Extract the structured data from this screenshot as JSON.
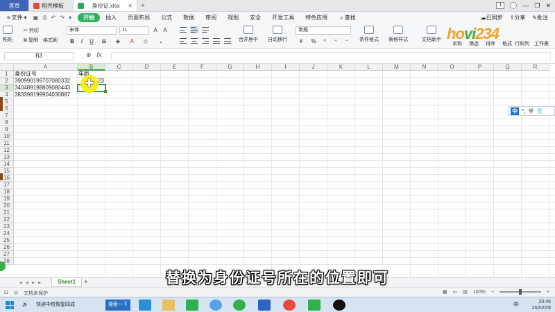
{
  "tabs": {
    "home": "首页",
    "template": "稻壳模板",
    "file": "身份证.xlsx",
    "tray_num": "1"
  },
  "menu": {
    "file": "文件",
    "items": [
      "开始",
      "插入",
      "页面布局",
      "公式",
      "数据",
      "审阅",
      "视图",
      "安全",
      "开发工具",
      "特色应用"
    ],
    "active_index": 0,
    "search": "查找",
    "sync": "已同步",
    "share": "分享",
    "comment": "批注"
  },
  "ribbon": {
    "paste": "粘贴",
    "cut": "剪切",
    "copy": "复制",
    "format_painter": "格式刷",
    "font_name": "宋体",
    "font_size": "11",
    "bold": "B",
    "italic": "I",
    "underline": "U",
    "merge": "合并居中",
    "wrap": "自动换行",
    "number_format": "常规",
    "conditional": "条件格式",
    "table_style": "表格样式",
    "doc_helper": "文档助手",
    "sum": "求和",
    "filter": "筛选",
    "sort": "排序",
    "fill": "格式",
    "row_col": "行和列",
    "worksheet": "工作表"
  },
  "logo": {
    "text_a": "ho",
    "text_b": "vi",
    "text_c": "234"
  },
  "formula_bar": {
    "name_box": "B3",
    "fx": "fx"
  },
  "grid": {
    "columns": [
      "A",
      "B",
      "C",
      "D",
      "E",
      "F",
      "G",
      "H",
      "I",
      "J",
      "K",
      "L",
      "M",
      "N",
      "O",
      "P",
      "Q",
      "R"
    ],
    "rows": [
      "1",
      "2",
      "3",
      "4",
      "5",
      "6",
      "7",
      "8",
      "9",
      "10",
      "11",
      "12",
      "13",
      "14",
      "15",
      "16",
      "17",
      "18",
      "19",
      "20",
      "21",
      "22",
      "23",
      "24",
      "25",
      "26",
      "27",
      "28"
    ],
    "selected_col": "B",
    "selected_row": "3",
    "cells": {
      "A1": "身份证号",
      "B1": "年龄",
      "A2": "390990199707080332",
      "B2": "23",
      "A3": "340489198809080443",
      "A4": "383398199904030887"
    }
  },
  "ime": {
    "mode": "中",
    "punct": "°,",
    "width": "半"
  },
  "subtitle": "替换为身份证号所在的位置即可",
  "sheet": {
    "tab": "Sheet1",
    "add": "+"
  },
  "status": {
    "protect": "文档未保护",
    "zoom": "100%"
  },
  "taskbar": {
    "app_item": "快递中包恢复四成",
    "search": "搜索一下",
    "time": "20:46",
    "date": "2020/2/8",
    "tray_lang": "中"
  }
}
